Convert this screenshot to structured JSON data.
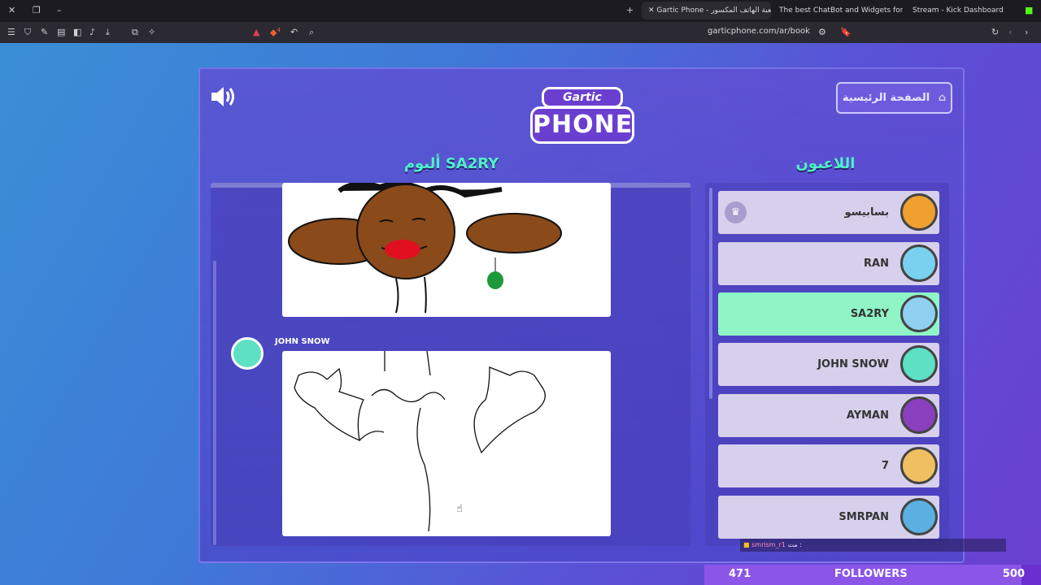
{
  "browser": {
    "tabs": [
      {
        "title": "Gartic Phone - لعبة الهاتف المكسور",
        "active": true
      },
      {
        "title": "The best ChatBot and Widgets for Kick",
        "active": false
      },
      {
        "title": "Stream - Kick Dashboard",
        "active": false
      }
    ],
    "url": "garticphone.com/ar/book",
    "shield_badge": "4"
  },
  "game": {
    "home_button_label": "الصفحة الرئيسية",
    "album_title": "ألبوم SA2RY",
    "players_title": "اللاعبون",
    "logo_top": "Gartic",
    "logo_bottom": "PHONE",
    "entry_author": "JOHN SNOW",
    "players": [
      {
        "name": "بسابيسو",
        "host": true,
        "current": false,
        "avatar_color": "#f0a030"
      },
      {
        "name": "RAN",
        "host": false,
        "current": false,
        "avatar_color": "#7ad0ef"
      },
      {
        "name": "SA2RY",
        "host": false,
        "current": true,
        "avatar_color": "#8fd0f0"
      },
      {
        "name": "JOHN SNOW",
        "host": false,
        "current": false,
        "avatar_color": "#5de0c4"
      },
      {
        "name": "AYMAN",
        "host": false,
        "current": false,
        "avatar_color": "#8a3fbf"
      },
      {
        "name": "7",
        "host": false,
        "current": false,
        "avatar_color": "#f0c060"
      },
      {
        "name": "SMRPAN",
        "host": false,
        "current": false,
        "avatar_color": "#5ab0e0"
      }
    ]
  },
  "overlay": {
    "chat_user": "smrism_r1",
    "chat_text": "مت :",
    "followers_label": "FOLLOWERS",
    "followers_current": "471",
    "followers_goal": "500",
    "followers_progress": 0.942
  }
}
